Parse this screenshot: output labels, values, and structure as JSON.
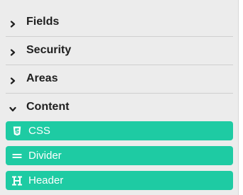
{
  "sections": [
    {
      "label": "Fields",
      "expanded": false,
      "icon": "chevron-right-icon"
    },
    {
      "label": "Security",
      "expanded": false,
      "icon": "chevron-right-icon"
    },
    {
      "label": "Areas",
      "expanded": false,
      "icon": "chevron-right-icon"
    },
    {
      "label": "Content",
      "expanded": true,
      "icon": "chevron-down-icon"
    }
  ],
  "content_items": [
    {
      "label": "CSS",
      "icon": "css3-icon"
    },
    {
      "label": "Divider",
      "icon": "equals-icon"
    },
    {
      "label": "Header",
      "icon": "heading-icon"
    }
  ],
  "colors": {
    "panel_bg": "#ececec",
    "item_bg": "#1ecba3",
    "item_text": "#ffffff",
    "label_text": "#1f1f1f",
    "divider": "#cfcfcf"
  }
}
